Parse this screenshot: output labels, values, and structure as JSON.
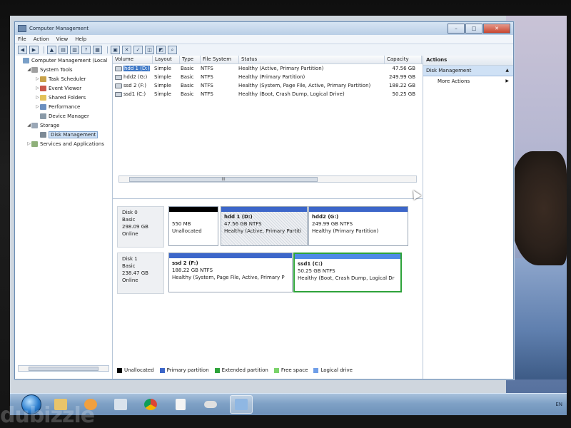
{
  "window": {
    "title": "Computer Management"
  },
  "menubar": {
    "items": [
      "File",
      "Action",
      "View",
      "Help"
    ]
  },
  "toolbar": {
    "icons": [
      "back-arrow-icon",
      "forward-arrow-icon",
      "up-folder-icon",
      "show-hide-tree-icon",
      "help-icon",
      "properties-icon",
      "close-x-icon",
      "check-icon",
      "connect-icon",
      "find-icon",
      "refresh-icon",
      "view-icon"
    ]
  },
  "tree": {
    "items": [
      {
        "label": "Computer Management (Local",
        "level": 0,
        "expander": "",
        "icon": "computer-icon"
      },
      {
        "label": "System Tools",
        "level": 1,
        "expander": "◢",
        "icon": "tools-icon"
      },
      {
        "label": "Task Scheduler",
        "level": 2,
        "expander": "▷",
        "icon": "clock-icon"
      },
      {
        "label": "Event Viewer",
        "level": 2,
        "expander": "▷",
        "icon": "event-icon"
      },
      {
        "label": "Shared Folders",
        "level": 2,
        "expander": "▷",
        "icon": "folder-icon"
      },
      {
        "label": "Performance",
        "level": 2,
        "expander": "▷",
        "icon": "performance-icon"
      },
      {
        "label": "Device Manager",
        "level": 2,
        "expander": "",
        "icon": "device-icon"
      },
      {
        "label": "Storage",
        "level": 1,
        "expander": "◢",
        "icon": "storage-icon"
      },
      {
        "label": "Disk Management",
        "level": 2,
        "expander": "",
        "icon": "disk-icon",
        "selected": true
      },
      {
        "label": "Services and Applications",
        "level": 1,
        "expander": "▷",
        "icon": "services-icon"
      }
    ]
  },
  "volume_table": {
    "headers": [
      "Volume",
      "Layout",
      "Type",
      "File System",
      "Status",
      "Capacity"
    ],
    "rows": [
      {
        "volume": "hdd 1 (D:)",
        "layout": "Simple",
        "type": "Basic",
        "fs": "NTFS",
        "status": "Healthy (Active, Primary Partition)",
        "capacity": "47.56 GB",
        "selected": true
      },
      {
        "volume": "hdd2 (G:)",
        "layout": "Simple",
        "type": "Basic",
        "fs": "NTFS",
        "status": "Healthy (Primary Partition)",
        "capacity": "249.99 GB"
      },
      {
        "volume": "ssd 2 (F:)",
        "layout": "Simple",
        "type": "Basic",
        "fs": "NTFS",
        "status": "Healthy (System, Page File, Active, Primary Partition)",
        "capacity": "188.22 GB"
      },
      {
        "volume": "ssd1 (C:)",
        "layout": "Simple",
        "type": "Basic",
        "fs": "NTFS",
        "status": "Healthy (Boot, Crash Dump, Logical Drive)",
        "capacity": "50.25 GB"
      }
    ],
    "hscroll_label": "III"
  },
  "disks": [
    {
      "name": "Disk 0",
      "type": "Basic",
      "size": "298.09 GB",
      "status": "Online",
      "partitions": [
        {
          "name": "",
          "size": "550 MB",
          "status": "Unallocated",
          "color": "#000000"
        },
        {
          "name": "hdd 1  (D:)",
          "size": "47.56 GB NTFS",
          "status": "Healthy (Active, Primary Partiti",
          "color": "#3c66c9",
          "hatched": true
        },
        {
          "name": "hdd2  (G:)",
          "size": "249.99 GB NTFS",
          "status": "Healthy (Primary Partition)",
          "color": "#3c66c9"
        }
      ]
    },
    {
      "name": "Disk 1",
      "type": "Basic",
      "size": "238.47 GB",
      "status": "Online",
      "partitions": [
        {
          "name": "ssd 2  (F:)",
          "size": "188.22 GB NTFS",
          "status": "Healthy (System, Page File, Active, Primary P",
          "color": "#3c66c9"
        },
        {
          "name": "ssd1  (C:)",
          "size": "50.25 GB NTFS",
          "status": "Healthy (Boot, Crash Dump, Logical Dr",
          "color": "#4e8ae6",
          "selected": true
        }
      ]
    }
  ],
  "legend": [
    {
      "label": "Unallocated",
      "color": "#000000"
    },
    {
      "label": "Primary partition",
      "color": "#3c66c9"
    },
    {
      "label": "Extended partition",
      "color": "#2ea33a"
    },
    {
      "label": "Free space",
      "color": "#7bd36a"
    },
    {
      "label": "Logical drive",
      "color": "#6f9ee8"
    }
  ],
  "actions": {
    "header": "Actions",
    "section": "Disk Management",
    "items": [
      "More Actions"
    ]
  },
  "taskbar": {
    "apps": [
      "explorer-icon",
      "media-player-icon",
      "computer-icon",
      "chrome-icon",
      "document-icon",
      "gamepad-icon",
      "disk-management-icon"
    ],
    "lang": "EN"
  },
  "watermark": {
    "text": "dubizzle"
  }
}
